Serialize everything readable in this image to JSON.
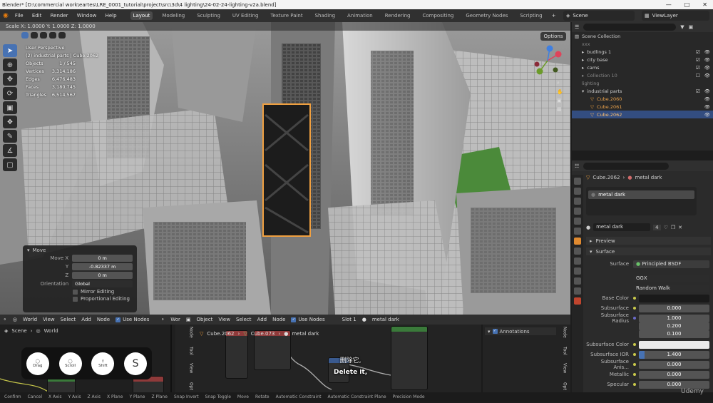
{
  "window": {
    "title": "Blender* [D:\\commercial work\\eartes\\LRE_0001_tutorial\\project\\src\\3d\\4 lighting\\24-02-24-lighting-v2a.blend]"
  },
  "menu": [
    "File",
    "Edit",
    "Render",
    "Window",
    "Help"
  ],
  "workspaces": [
    "Layout",
    "Modeling",
    "Sculpting",
    "UV Editing",
    "Texture Paint",
    "Shading",
    "Animation",
    "Rendering",
    "Compositing",
    "Geometry Nodes",
    "Scripting"
  ],
  "active_workspace": "Layout",
  "scene": "Scene",
  "view_layer": "ViewLayer",
  "viewport": {
    "header_text": "Scale X: 1.0000   Y: 1.0000   Z: 1.0000",
    "perspective": "User Perspective",
    "context": "(2) industrial parts | Cube.2062",
    "options_label": "Options",
    "stats": [
      {
        "label": "Objects",
        "value": "1 / 545"
      },
      {
        "label": "Vertices",
        "value": "3,314,186"
      },
      {
        "label": "Edges",
        "value": "6,476,483"
      },
      {
        "label": "Faces",
        "value": "3,180,745"
      },
      {
        "label": "Triangles",
        "value": "6,514,567"
      }
    ]
  },
  "move_panel": {
    "title": "Move",
    "move_x_label": "Move X",
    "x_value": "0 m",
    "y_label": "Y",
    "y_value": "-0.82337 m",
    "z_label": "Z",
    "z_value": "0 m",
    "orientation_label": "Orientation",
    "orientation_value": "Global",
    "mirror_editing": "Mirror Editing",
    "proportional_editing": "Proportional Editing"
  },
  "outliner": {
    "root": "Scene Collection",
    "items": [
      {
        "label": "xxx",
        "selected": false
      },
      {
        "label": "budlings 1",
        "selected": false
      },
      {
        "label": "city base",
        "selected": false
      },
      {
        "label": "cams",
        "selected": false
      },
      {
        "label": "Collection 10",
        "selected": false
      },
      {
        "label": "lighting",
        "selected": false
      },
      {
        "label": "industrial parts",
        "selected": false
      },
      {
        "label": "Cube.2060",
        "selected": false
      },
      {
        "label": "Cube.2061",
        "selected": false
      },
      {
        "label": "Cube.2062",
        "selected": true
      }
    ]
  },
  "properties": {
    "object": "Cube.2062",
    "material": "metal dark",
    "slot_material": "metal dark",
    "user_count": "4",
    "preview_label": "Preview",
    "surface_section": "Surface",
    "rows": [
      {
        "label": "Surface",
        "value": "Principled BSDF"
      },
      {
        "label": "",
        "value": "GGX"
      },
      {
        "label": "",
        "value": "Random Walk"
      },
      {
        "label": "Base Color",
        "value": ""
      },
      {
        "label": "Subsurface",
        "value": "0.000"
      },
      {
        "label": "Subsurface Radius",
        "value": "1.000"
      },
      {
        "label": "",
        "value": "0.200"
      },
      {
        "label": "",
        "value": "0.100"
      },
      {
        "label": "Subsurface Color",
        "value": ""
      },
      {
        "label": "Subsurface IOR",
        "value": "1.400"
      },
      {
        "label": "Subsurface Anis...",
        "value": "0.000"
      },
      {
        "label": "Metallic",
        "value": "0.000"
      },
      {
        "label": "Specular",
        "value": "0.000"
      }
    ]
  },
  "node_editor": {
    "left_header": [
      "World",
      "View",
      "Select",
      "Add",
      "Node",
      "Use Nodes"
    ],
    "breadcrumb_scene": "Scene",
    "breadcrumb_world": "World",
    "right_header": [
      "Object",
      "View",
      "Select",
      "Add",
      "Node",
      "Use Nodes",
      "Slot 1",
      "metal dark"
    ],
    "editor_prefix": "Wor",
    "breadcrumb_a": "Cube.2062",
    "breadcrumb_b": "Cube.073",
    "breadcrumb_c": "metal dark",
    "annotations": "Annotations",
    "side_tabs": [
      "Node",
      "Tool",
      "View",
      "Opt"
    ]
  },
  "keys": [
    {
      "label": "Drag",
      "big": false
    },
    {
      "label": "Scroll",
      "big": false
    },
    {
      "label": "Shift",
      "big": false
    },
    {
      "label": "S",
      "big": true
    }
  ],
  "subtitle": {
    "zh": "删除它,",
    "en": "Delete it,"
  },
  "statusbar": [
    "Confirm",
    "Cancel",
    "X Axis",
    "Y Axis",
    "Z Axis",
    "X Plane",
    "Y Plane",
    "Z Plane",
    "Snap Invert",
    "Snap Toggle",
    "Move",
    "Rotate",
    "Automatic Constraint",
    "Automatic Constraint Plane",
    "Precision Mode"
  ],
  "watermark": "Udemy"
}
